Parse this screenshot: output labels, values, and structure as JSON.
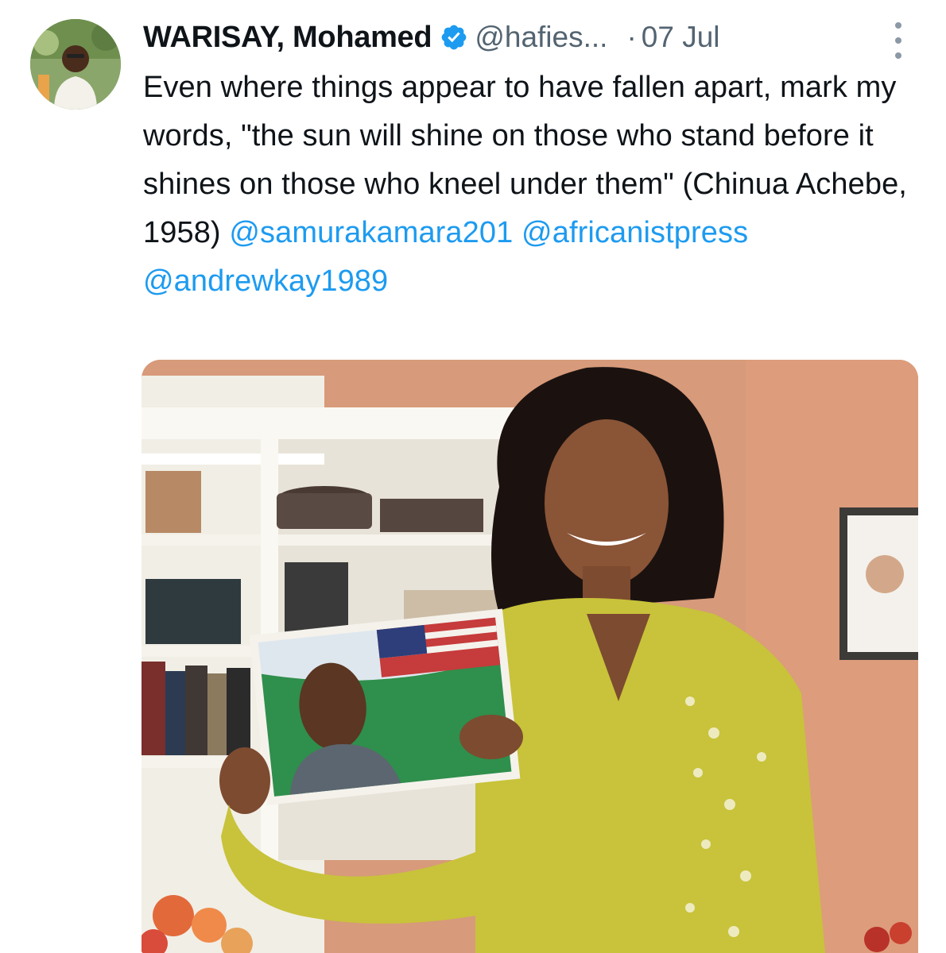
{
  "author": {
    "display_name": "WARISAY, Mohamed",
    "handle": "@hafies...",
    "verified": true
  },
  "tweet": {
    "separator": "·",
    "date": "07 Jul",
    "text_body": "Even where things appear to have fallen apart, mark my words, \"the sun will shine on those who stand before it shines on those who kneel under them\" (Chinua Achebe, 1958)",
    "mentions": [
      "@samurakamara201",
      "@africanistpress",
      "@andrewkay1989"
    ]
  },
  "icons": {
    "verified": "verified-badge-icon",
    "more": "more-options-icon"
  },
  "colors": {
    "text": "#0f1419",
    "secondary": "#536471",
    "link": "#1d9bf0",
    "verified": "#1d9bf0"
  }
}
